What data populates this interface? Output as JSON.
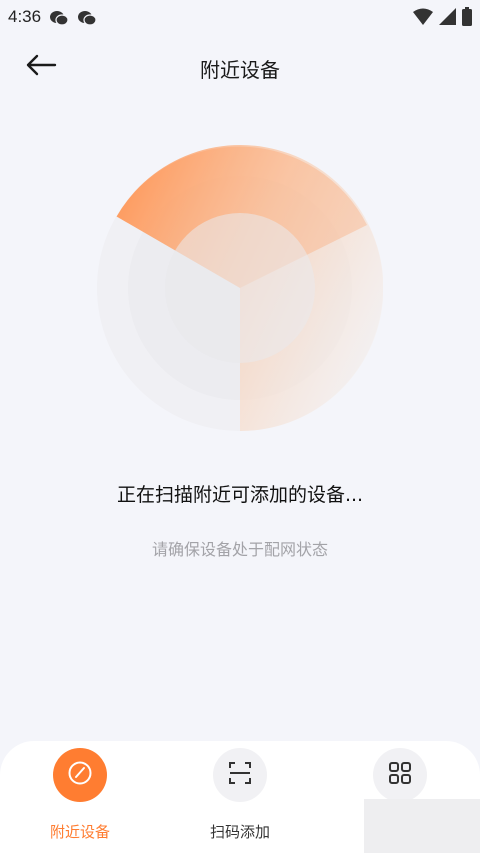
{
  "status_bar": {
    "time": "4:36",
    "app_icons": [
      "wechat-icon",
      "wechat-icon"
    ],
    "right_icons": [
      "wifi-icon",
      "signal-icon",
      "battery-icon"
    ]
  },
  "header": {
    "back_icon": "arrow-left-icon",
    "title": "附近设备"
  },
  "scan": {
    "title": "正在扫描附近可添加的设备...",
    "hint": "请确保设备处于配网状态"
  },
  "bottom_nav": {
    "items": [
      {
        "label": "附近设备",
        "icon": "gauge-icon",
        "active": true
      },
      {
        "label": "扫码添加",
        "icon": "scan-icon",
        "active": false
      },
      {
        "label": "",
        "icon": "grid-icon",
        "active": false
      }
    ]
  },
  "colors": {
    "accent": "#ff7d31",
    "background": "#f4f5fa",
    "hint_text": "#a3a3a8"
  }
}
